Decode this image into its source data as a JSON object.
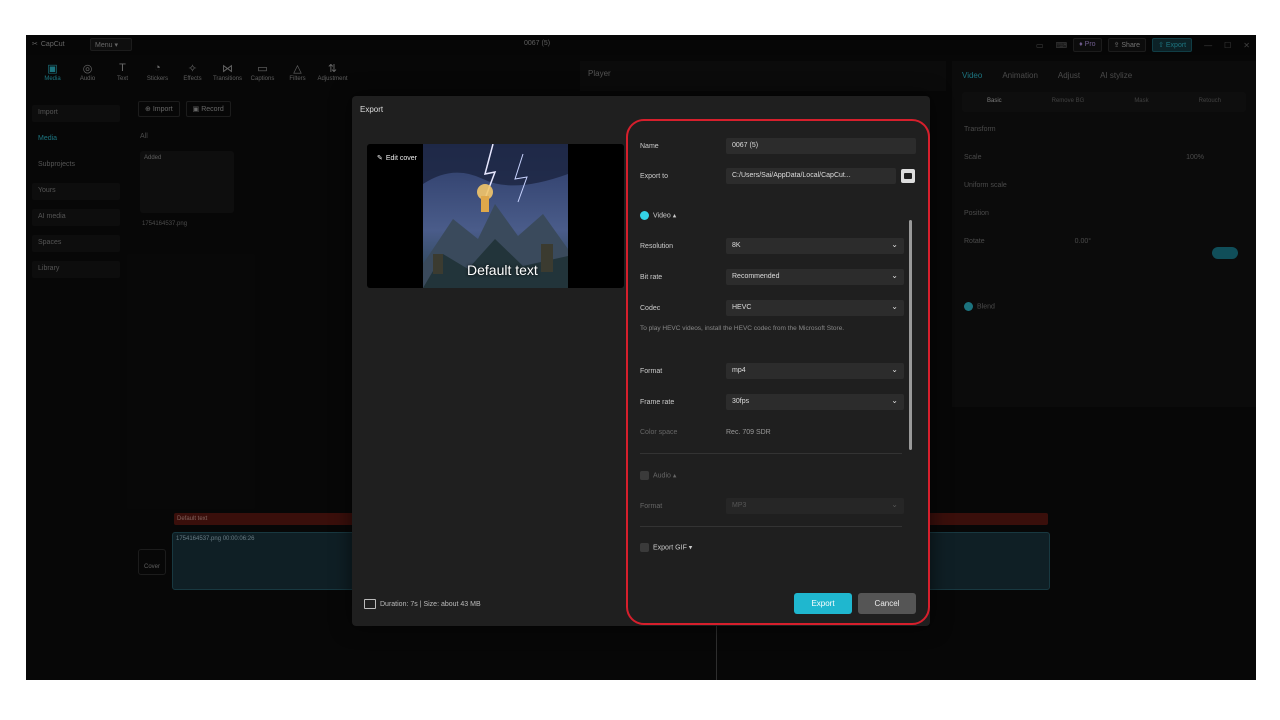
{
  "app": {
    "name": "CapCut",
    "menu_label": "Menu",
    "project_title": "0067 (5)",
    "pro_label": "Pro",
    "share_label": "Share",
    "export_label": "Export"
  },
  "toolbar": [
    {
      "label": "Media",
      "icon": "media-icon"
    },
    {
      "label": "Audio",
      "icon": "audio-icon"
    },
    {
      "label": "Text",
      "icon": "text-icon"
    },
    {
      "label": "Stickers",
      "icon": "stickers-icon"
    },
    {
      "label": "Effects",
      "icon": "effects-icon"
    },
    {
      "label": "Transitions",
      "icon": "transitions-icon"
    },
    {
      "label": "Captions",
      "icon": "captions-icon"
    },
    {
      "label": "Filters",
      "icon": "filters-icon"
    },
    {
      "label": "Adjustment",
      "icon": "adjustment-icon"
    }
  ],
  "left_panel": [
    "Import",
    "Media",
    "Subprojects",
    "Yours",
    "AI media",
    "Spaces",
    "Library"
  ],
  "media": {
    "import_label": "Import",
    "record_label": "Record",
    "all_label": "All",
    "added_label": "Added",
    "file_name": "1754164537.png"
  },
  "player": {
    "title": "Player"
  },
  "right_panel": {
    "tabs": [
      "Video",
      "Animation",
      "Adjust",
      "AI stylize"
    ],
    "subtabs": [
      "Basic",
      "Remove BG",
      "Mask",
      "Retouch"
    ],
    "transform_label": "Transform",
    "scale_label": "Scale",
    "scale_value": "100%",
    "uniform_label": "Uniform scale",
    "position_label": "Position",
    "rotate_label": "Rotate",
    "rotate_value": "0.00°",
    "blend_label": "Blend"
  },
  "timeline": {
    "text_track": "Default text",
    "clip_label": "1754164537.png  00:00:06:26",
    "cover_label": "Cover"
  },
  "dialog": {
    "title": "Export",
    "edit_cover": "Edit cover",
    "default_text": "Default text",
    "duration": "Duration: 7s | Size: about 43 MB",
    "name_label": "Name",
    "name_value": "0067 (5)",
    "export_to_label": "Export to",
    "export_to_value": "C:/Users/Sai/AppData/Local/CapCut...",
    "video_label": "Video",
    "resolution_label": "Resolution",
    "resolution_value": "8K",
    "bitrate_label": "Bit rate",
    "bitrate_value": "Recommended",
    "codec_label": "Codec",
    "codec_value": "HEVC",
    "codec_hint": "To play HEVC videos, install the HEVC codec from the Microsoft Store.",
    "format_label": "Format",
    "format_value": "mp4",
    "framerate_label": "Frame rate",
    "framerate_value": "30fps",
    "colorspace_label": "Color space",
    "colorspace_value": "Rec. 709 SDR",
    "audio_label": "Audio",
    "audio_format_label": "Format",
    "audio_format_value": "MP3",
    "gif_label": "Export GIF",
    "export_button": "Export",
    "cancel_button": "Cancel"
  },
  "colors": {
    "accent": "#34d2e6",
    "highlight": "#d61f2c"
  }
}
